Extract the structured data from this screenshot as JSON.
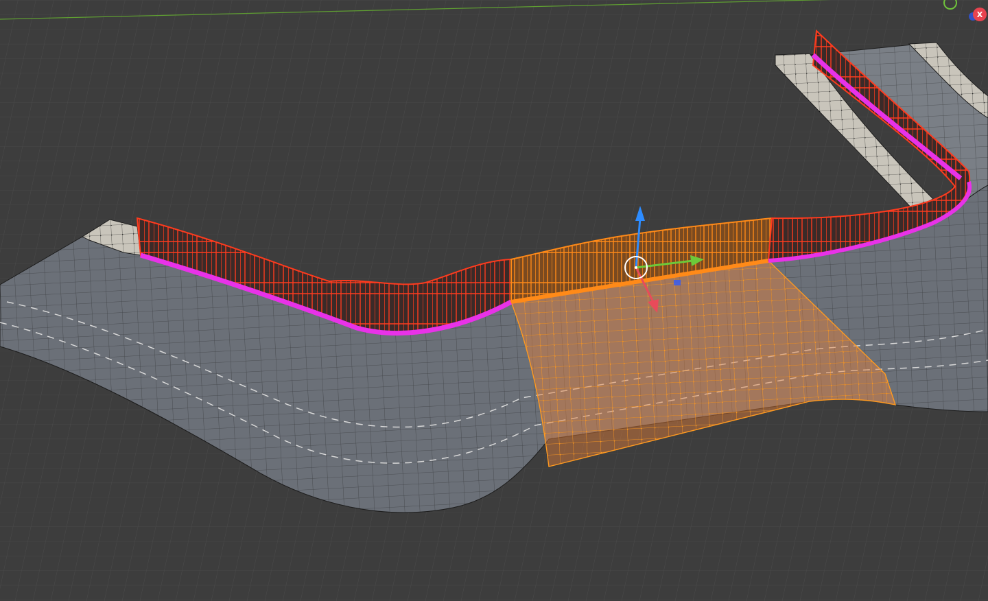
{
  "viewport": {
    "background": "#3d3d3d",
    "grid_color": "#4a4a4a",
    "x_axis_line_color": "#8a2a2a",
    "y_axis_line_color": "#5f9e32"
  },
  "scene": {
    "road_color": "#6b7078",
    "road_lane_dash_color": "#d8d8d8",
    "sidewalk_color": "#c9c5bb",
    "fence_unselected_color": "#ff3b1e",
    "fence_selected_color": "#ff8a18",
    "fence_base_color": "#e832e8",
    "selection_fill_color": "#e8813a",
    "selection_wire_color": "#ff9a20",
    "wire_color": "#1d1d1d"
  },
  "gizmo": {
    "z_color": "#2d8cff",
    "y_color": "#6cc93a",
    "x_color": "#e84b5a",
    "pivot_color": "#ffffff"
  },
  "navigation_gizmo": {
    "x_label": "X",
    "x_color": "#e8434f",
    "y_color": "#6fc33c"
  }
}
